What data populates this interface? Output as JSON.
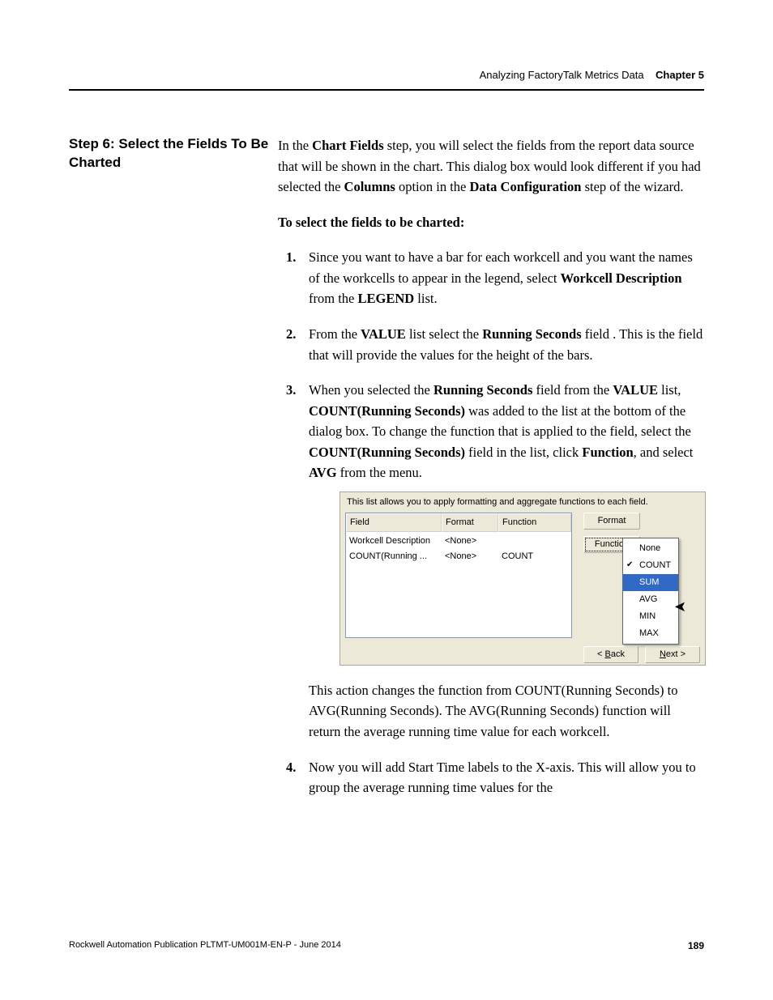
{
  "header": {
    "doc_title": "Analyzing FactoryTalk Metrics Data",
    "chapter": "Chapter 5"
  },
  "side_heading": "Step 6: Select the Fields To Be Charted",
  "intro": {
    "p1_a": "In the ",
    "p1_b": "Chart Fields",
    "p1_c": " step, you will select the fields from the report data source that will be shown in the chart. This dialog box would look different if you had selected the ",
    "p1_d": "Columns",
    "p1_e": " option in the ",
    "p1_f": "Data Configuration",
    "p1_g": " step of the wizard."
  },
  "instr_title": "To select the fields to be charted:",
  "steps": {
    "s1": {
      "num": "1.",
      "a": "Since you want to have a bar for each workcell and you want the names of the workcells to appear in the legend, select ",
      "b": "Workcell Description",
      "c": " from the ",
      "d": "LEGEND",
      "e": " list."
    },
    "s2": {
      "num": "2.",
      "a": "From the ",
      "b": "VALUE",
      "c": " list select the ",
      "d": "Running Seconds",
      "e": " field . This is the field that will provide the values for the height of the bars."
    },
    "s3": {
      "num": "3.",
      "a": "When you selected the ",
      "b": "Running Seconds",
      "c": " field from the ",
      "d": "VALUE",
      "e": " list, ",
      "f": "COUNT(Running Seconds)",
      "g": " was added to the list at the bottom of the dialog box. To change the function that is applied to the field, select the ",
      "h": "COUNT(Running Seconds)",
      "i": " field in the list, click ",
      "j": "Function",
      "k": ", and select ",
      "l": "AVG",
      "m": " from the menu."
    },
    "s3_after": "This action changes the function from COUNT(Running Seconds) to AVG(Running Seconds). The AVG(Running Seconds) function will return the average running time value for each workcell.",
    "s4": {
      "num": "4.",
      "a": "Now you will add Start Time labels to the X-axis. This will allow you to group the average running time values for the"
    }
  },
  "dialog": {
    "caption": "This list allows you to apply formatting and aggregate functions to each field.",
    "cols": {
      "c1": "Field",
      "c2": "Format",
      "c3": "Function"
    },
    "rows": [
      {
        "c1": "Workcell Description",
        "c2": "<None>",
        "c3": ""
      },
      {
        "c1": "COUNT(Running ...",
        "c2": "<None>",
        "c3": "COUNT"
      }
    ],
    "btn_format": "Format",
    "btn_function": "Function",
    "menu": [
      "None",
      "COUNT",
      "SUM",
      "AVG",
      "MIN",
      "MAX"
    ],
    "btn_back_u": "B",
    "btn_back_rest": "ack",
    "btn_back_prefix": "< ",
    "btn_next_u": "N",
    "btn_next_rest": "ext >"
  },
  "footer": {
    "pub": "Rockwell Automation Publication PLTMT-UM001M-EN-P - June 2014",
    "page": "189"
  }
}
